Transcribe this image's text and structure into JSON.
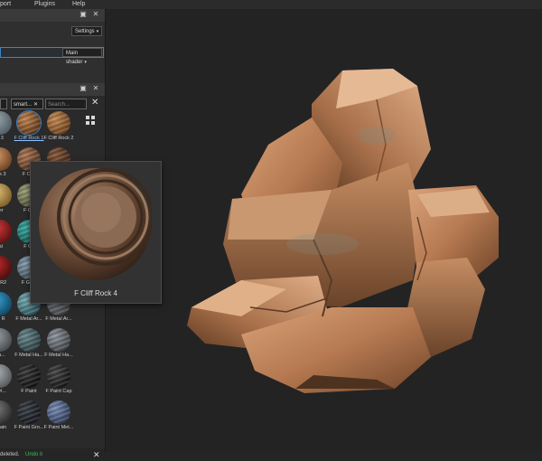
{
  "menubar": {
    "items": [
      "port",
      "Plugins",
      "Help"
    ]
  },
  "texture_set_settings": {
    "settings_label": "Settings",
    "shader_label": "Main shader"
  },
  "shelf": {
    "search_value": "smart...",
    "search_placeholder": "Search...",
    "materials": [
      {
        "label": "o 3"
      },
      {
        "label": "F Cliff Rock 1"
      },
      {
        "label": "F Cliff Rock 2"
      },
      {
        "label": "ock 3"
      },
      {
        "label": "F Cliff"
      },
      {
        "label": ""
      },
      {
        "label": "zer"
      },
      {
        "label": "F Co"
      },
      {
        "label": ""
      },
      {
        "label": "tal"
      },
      {
        "label": "F Cy"
      },
      {
        "label": ""
      },
      {
        "label": "tal R2"
      },
      {
        "label": "F Galv"
      },
      {
        "label": ""
      },
      {
        "label": "tal R"
      },
      {
        "label": "F Metal Ar..."
      },
      {
        "label": "F Metal Ar..."
      },
      {
        "label": "Ha..."
      },
      {
        "label": "F Metal Ha..."
      },
      {
        "label": "F Metal Ha..."
      },
      {
        "label": "Styl..."
      },
      {
        "label": "F Paint"
      },
      {
        "label": "F Paint Cap"
      },
      {
        "label": "Chain"
      },
      {
        "label": "F Paint Gro..."
      },
      {
        "label": "F Paint Met..."
      }
    ]
  },
  "preview_popup": {
    "label": "F Cliff Rock 4"
  },
  "status": {
    "text": "deleted.",
    "undo_label": "Undo it"
  },
  "colors": {
    "accent": "#3b84c9",
    "undo": "#3fbf5f"
  }
}
